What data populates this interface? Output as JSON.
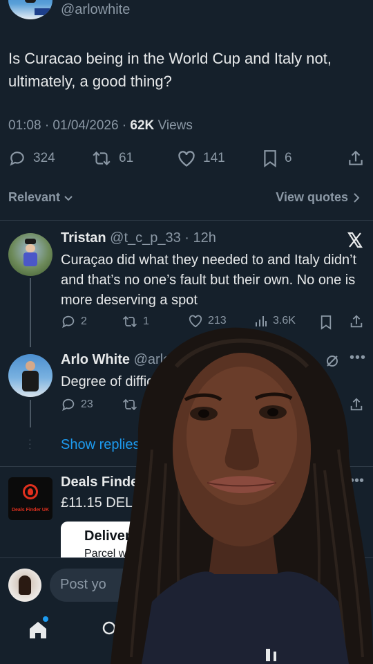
{
  "tweet": {
    "handle": "@arlowhite",
    "text": "Is Curacao being in the World Cup and Italy not, ultimately, a good thing?",
    "time": "01:08 · 01/04/2026 ·",
    "views_count": "62K",
    "views_label": "Views",
    "replies": "324",
    "retweets": "61",
    "likes": "141",
    "bookmarks": "6"
  },
  "filter": {
    "sort_label": "Relevant",
    "view_quotes_label": "View quotes"
  },
  "reply1": {
    "name": "Tristan",
    "meta": "@t_c_p_33 · 12h",
    "text": "Curaçao did what they needed to and Italy didn’t and that’s no one’s fault but their own. No one is more deserving a spot",
    "replies": "2",
    "retweets": "1",
    "likes": "213",
    "views": "3.6K"
  },
  "reply2": {
    "name": "Arlo White",
    "handle": "@arlow",
    "text": "Degree of difficult",
    "replies": "23"
  },
  "show_replies_label": "Show replies",
  "ad": {
    "name": "Deals Finder U",
    "logo_text": "Deals Finder UK",
    "text": "£11.15 DELIVE",
    "card_title": "Deliver",
    "card_subtitle": "Parcel w"
  },
  "composer": {
    "placeholder": "Post yo"
  },
  "colors": {
    "background": "#15202b",
    "accent": "#1d9bf0",
    "muted": "#8b98a5",
    "ad_logo": "#e0301e"
  }
}
